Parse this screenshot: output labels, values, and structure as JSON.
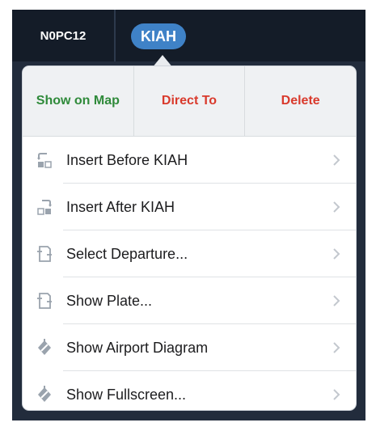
{
  "topbar": {
    "waypoint_previous": "N0PC12",
    "waypoint_selected": "KIAH"
  },
  "popover": {
    "actions": {
      "show_on_map": "Show on Map",
      "direct_to": "Direct To",
      "delete": "Delete"
    },
    "items": [
      {
        "label": "Insert Before KIAH",
        "icon": "insert-before-icon"
      },
      {
        "label": "Insert After KIAH",
        "icon": "insert-after-icon"
      },
      {
        "label": "Select Departure...",
        "icon": "departure-plate-icon"
      },
      {
        "label": "Show Plate...",
        "icon": "plate-icon"
      },
      {
        "label": "Show Airport Diagram",
        "icon": "airport-diagram-icon"
      },
      {
        "label": "Show Fullscreen...",
        "icon": "fullscreen-diagram-icon"
      }
    ]
  },
  "colors": {
    "accent_blue": "#3f82c7",
    "action_green": "#2f8a3a",
    "action_red": "#d93a2c",
    "icon_gray": "#9aa3ad"
  }
}
